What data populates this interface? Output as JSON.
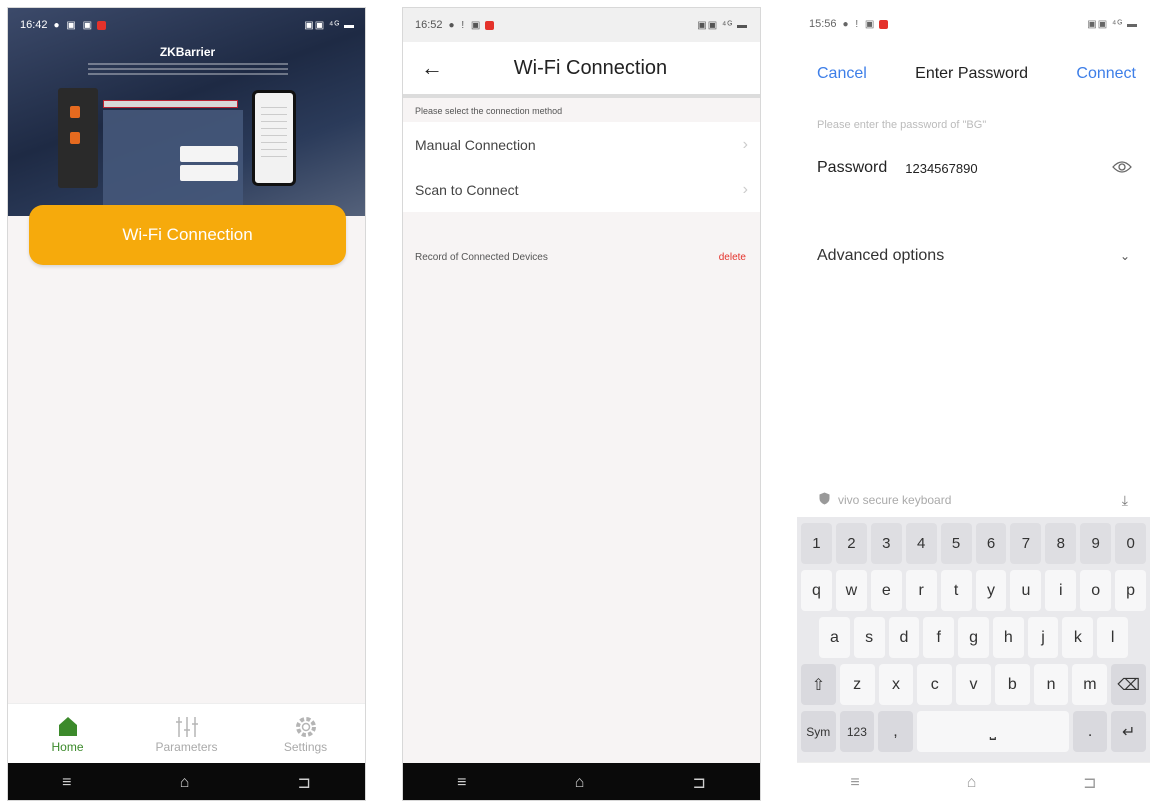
{
  "phone1": {
    "status": {
      "time": "16:42",
      "left_icons": "● ▣ ▣",
      "right_icons": "▣▣ ⁴ᴳ ▬"
    },
    "banner": {
      "brand": "ZKBarrier"
    },
    "primary_button": "Wi-Fi Connection",
    "tabs": [
      {
        "label": "Home",
        "icon": "home-icon"
      },
      {
        "label": "Parameters",
        "icon": "sliders-icon"
      },
      {
        "label": "Settings",
        "icon": "gear-icon"
      }
    ],
    "nav": {
      "menu": "≡",
      "home": "⌂",
      "back": "⊐"
    }
  },
  "phone2": {
    "status": {
      "time": "16:52",
      "left_icons": "● ! ▣",
      "right_icons": "▣▣ ⁴ᴳ ▬"
    },
    "title": "Wi-Fi Connection",
    "hint": "Please select the connection method",
    "items": [
      {
        "label": "Manual Connection"
      },
      {
        "label": "Scan to Connect"
      }
    ],
    "record_label": "Record of Connected Devices",
    "delete_label": "delete",
    "nav": {
      "menu": "≡",
      "home": "⌂",
      "back": "⊐"
    }
  },
  "phone3": {
    "status": {
      "time": "15:56",
      "left_icons": "● ! ▣",
      "right_icons": "▣▣ ⁴ᴳ ▬"
    },
    "cancel": "Cancel",
    "title": "Enter Password",
    "connect": "Connect",
    "hint": "Please enter the password of \"BG\"",
    "password_label": "Password",
    "password_value": "1234567890",
    "advanced": "Advanced options",
    "keyboard_label": "vivo secure keyboard",
    "keys": {
      "numbers": [
        "1",
        "2",
        "3",
        "4",
        "5",
        "6",
        "7",
        "8",
        "9",
        "0"
      ],
      "row1": [
        "q",
        "w",
        "e",
        "r",
        "t",
        "y",
        "u",
        "i",
        "o",
        "p"
      ],
      "row2": [
        "a",
        "s",
        "d",
        "f",
        "g",
        "h",
        "j",
        "k",
        "l"
      ],
      "row3": [
        "z",
        "x",
        "c",
        "v",
        "b",
        "n",
        "m"
      ],
      "sym": "Sym",
      "num": "123",
      "comma": ",",
      "period": "."
    },
    "nav": {
      "menu": "≡",
      "home": "⌂",
      "back": "⊐"
    }
  }
}
